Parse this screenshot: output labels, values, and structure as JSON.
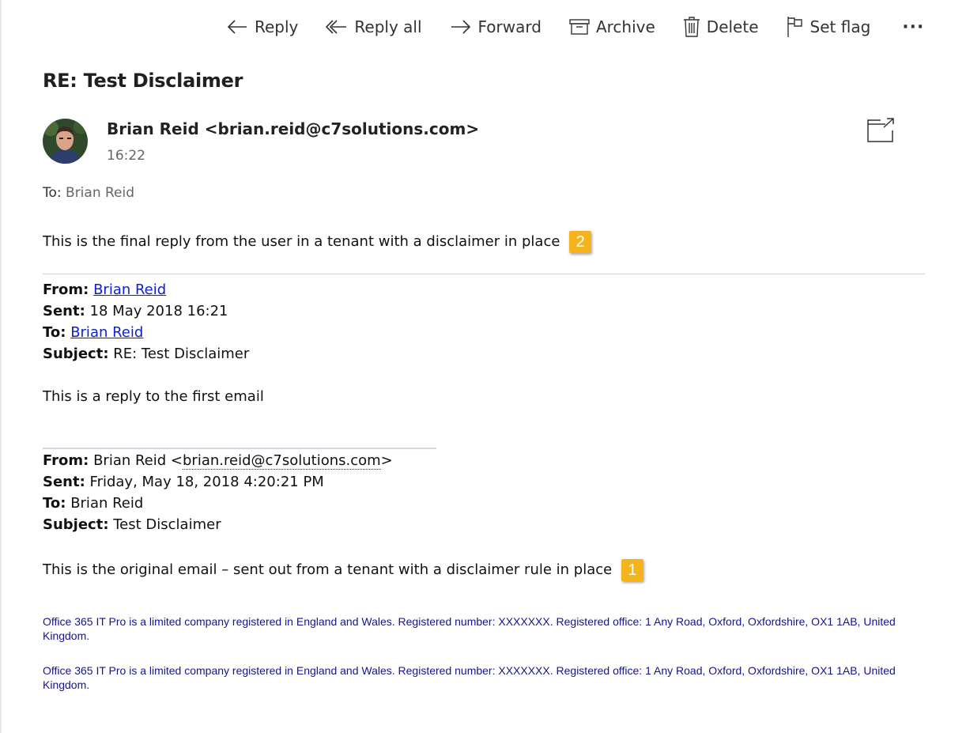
{
  "toolbar": {
    "reply": "Reply",
    "reply_all": "Reply all",
    "forward": "Forward",
    "archive": "Archive",
    "delete": "Delete",
    "set_flag": "Set flag",
    "more": "···"
  },
  "message": {
    "subject": "RE: Test Disclaimer",
    "sender": "Brian Reid <brian.reid@c7solutions.com>",
    "time": "16:22",
    "to_label": "To:",
    "to_name": "Brian Reid",
    "body": "This is the final reply from the user in a tenant with a disclaimer in place",
    "badge": "2"
  },
  "quoted1": {
    "from_label": "From:",
    "from": "Brian Reid",
    "sent_label": "Sent:",
    "sent": "18 May 2018 16:21",
    "to_label": "To:",
    "to": "Brian Reid",
    "subject_label": "Subject:",
    "subject": "RE: Test Disclaimer",
    "body": "This is a reply to the first email"
  },
  "quoted2": {
    "from_label": "From:",
    "from_name": "Brian Reid <",
    "from_email": "brian.reid@c7solutions.com",
    "from_close": ">",
    "sent_label": "Sent:",
    "sent": "Friday, May 18, 2018 4:20:21 PM",
    "to_label": "To:",
    "to": "Brian Reid",
    "subject_label": "Subject:",
    "subject": "Test Disclaimer",
    "body": "This is the original email – sent out from a tenant with a disclaimer rule in place",
    "badge": "1"
  },
  "disclaimers": [
    "Office 365 IT Pro is a limited company registered in England and Wales. Registered number: XXXXXXX. Registered office: 1 Any Road, Oxford, Oxfordshire, OX1 1AB, United Kingdom.",
    "Office 365 IT Pro is a limited company registered in England and Wales. Registered number: XXXXXXX. Registered office: 1 Any Road, Oxford, Oxfordshire, OX1 1AB, United Kingdom."
  ],
  "colors": {
    "link": "#0b20d6",
    "disclaimer": "#15158c",
    "badge": "#f5b41b"
  },
  "icons": [
    "reply-icon",
    "reply-all-icon",
    "forward-icon",
    "archive-icon",
    "delete-icon",
    "flag-icon",
    "more-icon",
    "popout-icon"
  ]
}
